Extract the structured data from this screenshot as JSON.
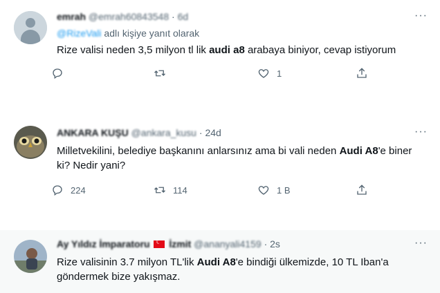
{
  "tweets": [
    {
      "name": "emrah",
      "handle": "@emrah60843548",
      "time": "6d",
      "more": "···",
      "reply_to_handle": "@RizeVali",
      "reply_to_suffix": "adlı kişiye yanıt olarak",
      "text_before": "Rize valisi neden 3,5 milyon tl lik ",
      "text_bold": "audi a8",
      "text_after": " arabaya biniyor, cevap istiyorum",
      "counts": {
        "reply": "",
        "retweet": "",
        "like": "1"
      }
    },
    {
      "name": "ANKARA KUŞU",
      "handle": "@ankara_kusu",
      "time": "24d",
      "more": "···",
      "text_before": "Milletvekilini, belediye başkanını anlarsınız ama bi vali neden ",
      "text_bold": "Audi A8",
      "text_after": "'e biner ki? Nedir yani?",
      "counts": {
        "reply": "224",
        "retweet": "114",
        "like": "1 B"
      }
    },
    {
      "name": "Ay Yıldız İmparatoru",
      "name_suffix": "İzmit",
      "handle": "@ananyali4159",
      "time": "2s",
      "more": "···",
      "text_before": "Rize valisinin 3.7 milyon TL'lik ",
      "text_bold": "Audi A8",
      "text_after": "'e bindiği ülkemizde, 10 TL Iban'a göndermek bize yakışmaz."
    }
  ],
  "colors": {
    "accent": "#1d9bf0",
    "muted": "#536471",
    "text": "#0f1419"
  },
  "icons": [
    "reply-icon",
    "retweet-icon",
    "like-icon",
    "share-icon",
    "more-icon",
    "turkish-flag-icon"
  ]
}
